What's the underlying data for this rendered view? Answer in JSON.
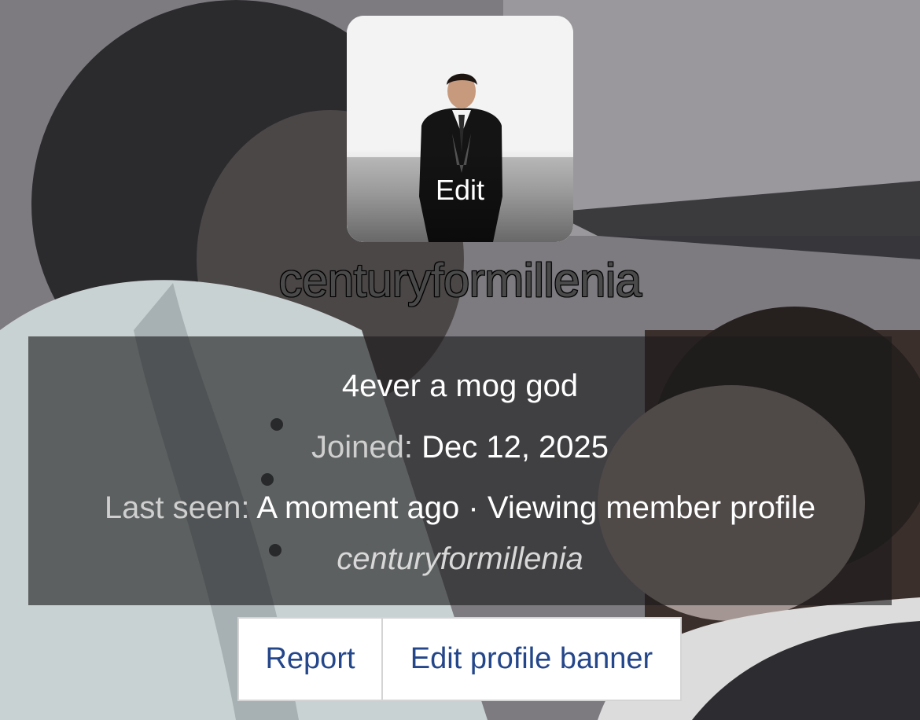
{
  "profile": {
    "username": "centuryformillenia",
    "avatar_edit_label": "Edit",
    "tagline": "4ever a mog god",
    "joined_label": "Joined:",
    "joined_value": "Dec 12, 2025",
    "last_seen_label": "Last seen:",
    "last_seen_value": "A moment ago",
    "separator": "·",
    "activity": "Viewing member profile",
    "activity_target": "centuryformillenia"
  },
  "actions": {
    "report_label": "Report",
    "edit_banner_label": "Edit profile banner"
  },
  "colors": {
    "link": "#24468a",
    "panel": "rgba(28,26,28,0.62)"
  }
}
